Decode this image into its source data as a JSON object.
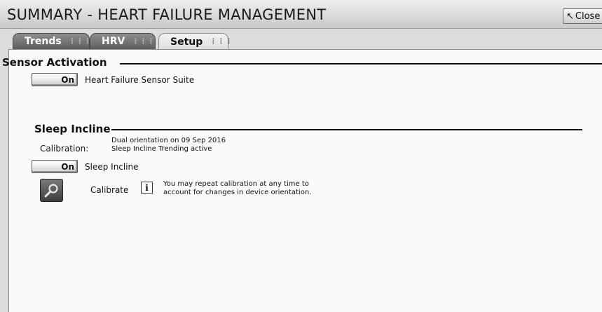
{
  "window": {
    "title": "SUMMARY - HEART FAILURE MANAGEMENT",
    "close_label": "Close"
  },
  "tabs": [
    {
      "label": "Trends",
      "active": false
    },
    {
      "label": "HRV",
      "active": false
    },
    {
      "label": "Setup",
      "active": true
    }
  ],
  "sensor_activation": {
    "heading": "Sensor Activation",
    "toggle_label": "On",
    "item_label": "Heart Failure Sensor Suite"
  },
  "sleep_incline": {
    "heading": "Sleep Incline",
    "calibration_label": "Calibration:",
    "calibration_lines": [
      "Dual orientation on 09 Sep 2016",
      "Sleep Incline Trending active"
    ],
    "toggle_label": "On",
    "item_label": "Sleep Incline",
    "calibrate_label": "Calibrate",
    "info_lines": [
      "You may repeat calibration at any time to",
      "account for changes in device orientation."
    ]
  },
  "icons": {
    "close": "cursor-arrow-icon",
    "calibrate": "magnifier-icon",
    "info": "info-icon"
  },
  "colors": {
    "tab_inactive": "#5e5e5e",
    "panel_bg": "#fafafa",
    "title_bg": "#d4d4d4"
  }
}
